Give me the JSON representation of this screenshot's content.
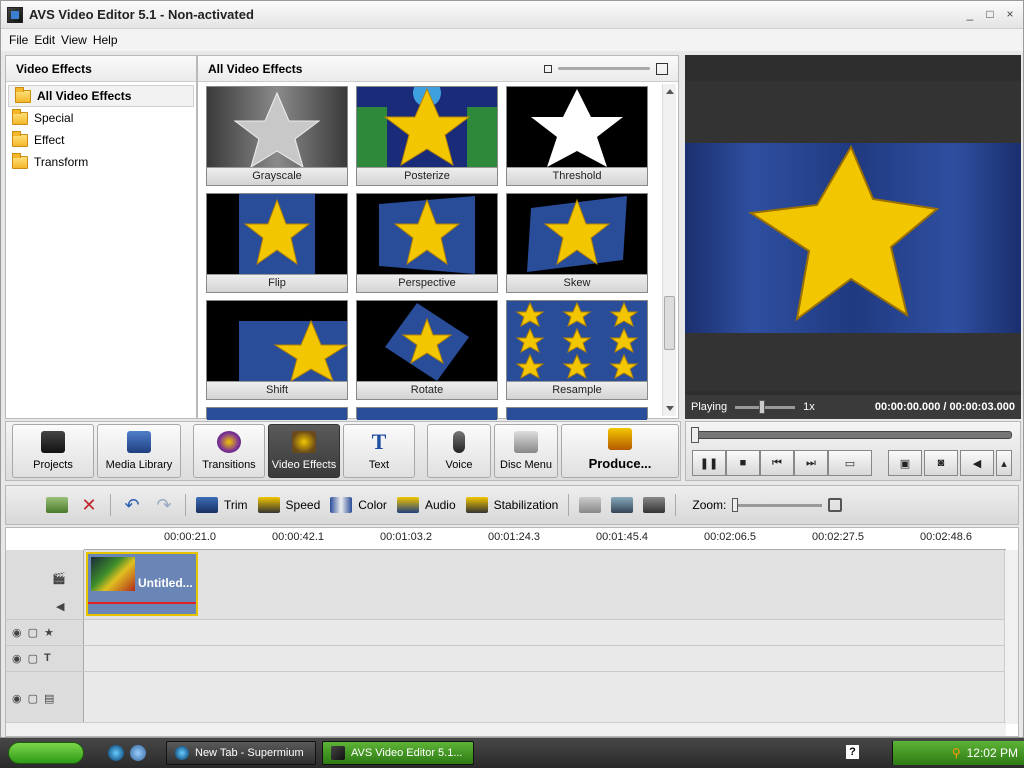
{
  "window": {
    "title": "AVS Video Editor 5.1 - Non-activated",
    "controls": [
      "_",
      "□",
      "×"
    ]
  },
  "menu": [
    {
      "label": "File"
    },
    {
      "label": "Edit"
    },
    {
      "label": "View"
    },
    {
      "label": "Help"
    }
  ],
  "tree": {
    "header": "Video Effects",
    "items": [
      "All Video Effects",
      "Special",
      "Effect",
      "Transform"
    ]
  },
  "effects": {
    "header": "All Video Effects",
    "items": [
      "Grayscale",
      "Posterize",
      "Threshold",
      "Flip",
      "Perspective",
      "Skew",
      "Shift",
      "Rotate",
      "Resample"
    ]
  },
  "preview": {
    "status": "Playing",
    "speed": "1x",
    "current_time": "00:00:00.000",
    "separator": "/",
    "total_time": "00:00:03.000"
  },
  "toolbar": {
    "buttons": [
      "Projects",
      "Media Library",
      "Transitions",
      "Video Effects",
      "Text",
      "Voice",
      "Disc Menu",
      "Produce..."
    ],
    "active": "Video Effects"
  },
  "edit_toolbar": {
    "tools": [
      "Trim",
      "Speed",
      "Color",
      "Audio",
      "Stabilization"
    ],
    "zoom_label": "Zoom:"
  },
  "timeline": {
    "ticks": [
      "00:00:21.0",
      "00:00:42.1",
      "00:01:03.2",
      "00:01:24.3",
      "00:01:45.4",
      "00:02:06.5",
      "00:02:27.5",
      "00:02:48.6"
    ],
    "clip_name": "Untitled..."
  },
  "taskbar": {
    "tasks": [
      "New Tab - Supermium",
      "AVS Video Editor 5.1..."
    ],
    "clock": "12:02 PM",
    "help": "?"
  }
}
